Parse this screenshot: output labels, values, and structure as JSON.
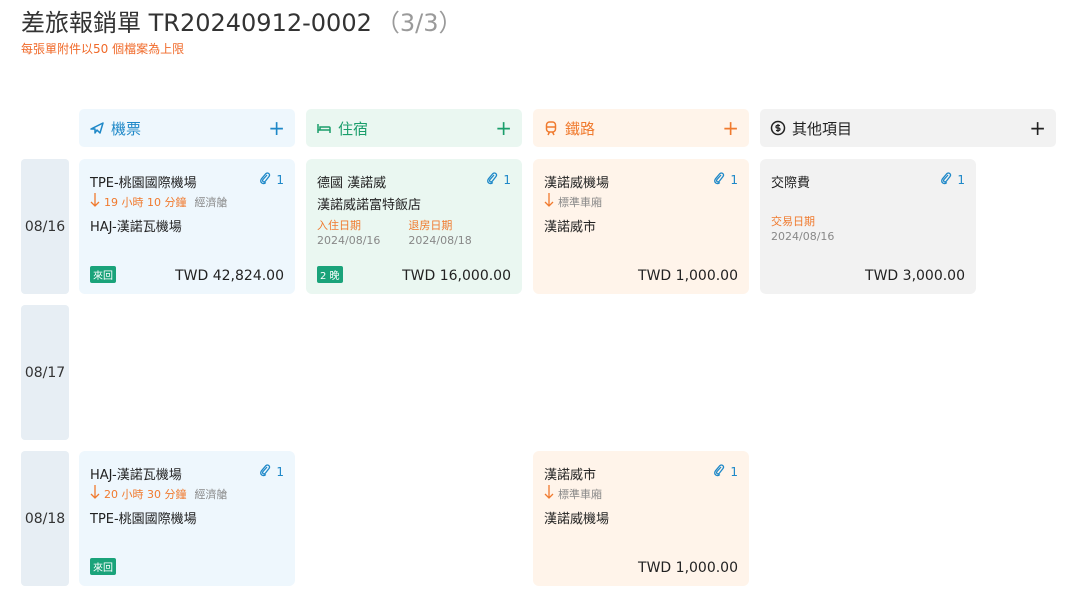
{
  "header": {
    "title": "差旅報銷單 TR20240912-0002",
    "step": "（3/3）",
    "notice": "每張單附件以50 個檔案為上限"
  },
  "columns": {
    "air": {
      "label": "機票",
      "icon": "airplane-icon",
      "color": "#1e88c8"
    },
    "hotel": {
      "label": "住宿",
      "icon": "bed-icon",
      "color": "#1a9e6b"
    },
    "rail": {
      "label": "鐵路",
      "icon": "train-icon",
      "color": "#f07a2e"
    },
    "other": {
      "label": "其他項目",
      "icon": "dollar-icon",
      "color": "#222222"
    },
    "add_symbol": "+"
  },
  "days": [
    "08/16",
    "08/17",
    "08/18"
  ],
  "cards": {
    "air1": {
      "from": "TPE-桃園國際機場",
      "attach": "1",
      "duration": "19 小時 10 分鐘",
      "cabin": "經濟艙",
      "to": "HAJ-漢諾瓦機場",
      "badge": "來回",
      "amount": "TWD 42,824.00"
    },
    "hotel1": {
      "place": "德國 漢諾威",
      "attach": "1",
      "name": "漢諾威諾富特飯店",
      "checkin_label": "入住日期",
      "checkin": "2024/08/16",
      "checkout_label": "退房日期",
      "checkout": "2024/08/18",
      "badge": "2 晚",
      "amount": "TWD 16,000.00"
    },
    "rail1": {
      "from": "漢諾威機場",
      "attach": "1",
      "class": "標準車廂",
      "to": "漢諾威市",
      "amount": "TWD 1,000.00"
    },
    "other1": {
      "item": "交際費",
      "attach": "1",
      "date_label": "交易日期",
      "date": "2024/08/16",
      "amount": "TWD 3,000.00"
    },
    "air2": {
      "from": "HAJ-漢諾瓦機場",
      "attach": "1",
      "duration": "20 小時 30 分鐘",
      "cabin": "經濟艙",
      "to": "TPE-桃園國際機場",
      "badge": "來回"
    },
    "rail2": {
      "from": "漢諾威市",
      "attach": "1",
      "class": "標準車廂",
      "to": "漢諾威機場",
      "amount": "TWD 1,000.00"
    }
  }
}
